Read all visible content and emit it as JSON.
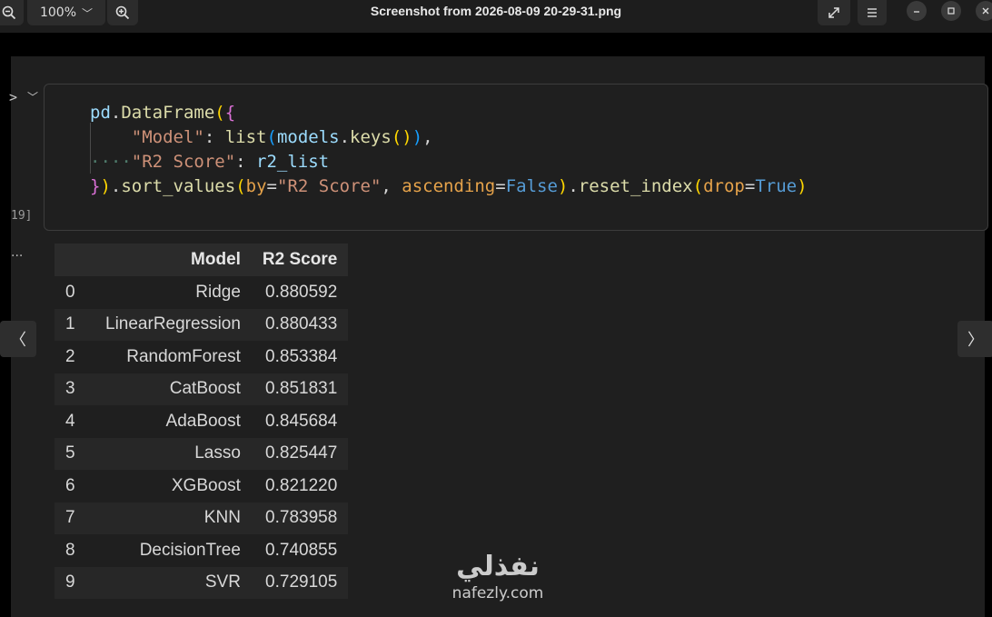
{
  "viewer": {
    "title": "Screenshot from 2026-08-09 20-29-31.png",
    "zoom_level": "100%",
    "icons": {
      "zoom_out": "zoom-out-icon",
      "zoom_in": "zoom-in-icon",
      "zoom_dropdown": "chevron-down-icon",
      "fullscreen": "expand-icon",
      "menu": "hamburger-menu-icon",
      "minimize": "minimize-icon",
      "maximize": "maximize-icon",
      "close": "close-icon",
      "prev": "chevron-left-icon",
      "next": "chevron-right-icon"
    }
  },
  "notebook": {
    "execution_count": "19]",
    "output_marker": "...",
    "code_lines": [
      "pd.DataFrame({",
      "    \"Model\": list(models.keys()),",
      "    \"R2 Score\": r2_list",
      "}).sort_values(by=\"R2 Score\", ascending=False).reset_index(drop=True)"
    ],
    "table": {
      "headers": [
        "",
        "Model",
        "R2 Score"
      ],
      "rows": [
        {
          "index": "0",
          "model": "Ridge",
          "score": "0.880592"
        },
        {
          "index": "1",
          "model": "LinearRegression",
          "score": "0.880433"
        },
        {
          "index": "2",
          "model": "RandomForest",
          "score": "0.853384"
        },
        {
          "index": "3",
          "model": "CatBoost",
          "score": "0.851831"
        },
        {
          "index": "4",
          "model": "AdaBoost",
          "score": "0.845684"
        },
        {
          "index": "5",
          "model": "Lasso",
          "score": "0.825447"
        },
        {
          "index": "6",
          "model": "XGBoost",
          "score": "0.821220"
        },
        {
          "index": "7",
          "model": "KNN",
          "score": "0.783958"
        },
        {
          "index": "8",
          "model": "DecisionTree",
          "score": "0.740855"
        },
        {
          "index": "9",
          "model": "SVR",
          "score": "0.729105"
        }
      ]
    }
  },
  "watermark": {
    "arabic": "نفذلي",
    "url": "nafezly.com"
  },
  "colors": {
    "background": "#000000",
    "panel": "#1f1f1f",
    "header_row": "#2b2b2b",
    "string": "#ce9178",
    "function": "#dcdcaa",
    "keyword": "#569cd6",
    "variable": "#9cdcfe"
  }
}
